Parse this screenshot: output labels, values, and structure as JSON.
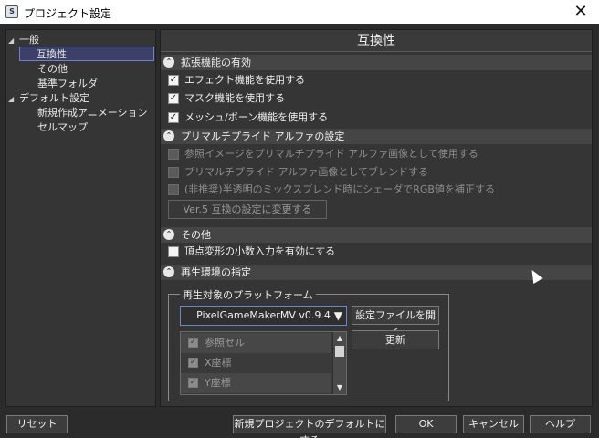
{
  "window": {
    "title": "プロジェクト設定",
    "close": "✕"
  },
  "tree": {
    "items": [
      {
        "label": "一般",
        "arrow": "◢"
      },
      {
        "label": "互換性"
      },
      {
        "label": "その他"
      },
      {
        "label": "基準フォルダ"
      },
      {
        "label": "デフォルト設定",
        "arrow": "◢"
      },
      {
        "label": "新規作成アニメーション"
      },
      {
        "label": "セルマップ"
      }
    ]
  },
  "panel": {
    "title": "互換性",
    "sections": {
      "ext": {
        "header": "拡張機能の有効",
        "items": [
          {
            "label": "エフェクト機能を使用する",
            "check": "✓"
          },
          {
            "label": "マスク機能を使用する",
            "check": "✓"
          },
          {
            "label": "メッシュ/ボーン機能を使用する",
            "check": "✓"
          }
        ]
      },
      "premul": {
        "header": "プリマルチプライド アルファの設定",
        "items": [
          {
            "label": "参照イメージをプリマルチプライド アルファ画像として使用する"
          },
          {
            "label": "プリマルチプライド アルファ画像としてブレンドする"
          },
          {
            "label": "(非推奨)半透明のミックスブレンド時にシェーダでRGB値を補正する"
          }
        ],
        "ver5_button": "Ver.5 互換の設定に変更する"
      },
      "other": {
        "header": "その他",
        "items": [
          {
            "label": "頂点変形の小数入力を有効にする"
          }
        ]
      },
      "playback": {
        "header": "再生環境の指定",
        "group_label": "再生対象のプラットフォーム",
        "platform": "PixelGameMakerMV v0.9.4",
        "open_settings": "設定ファイルを開く",
        "update": "更新",
        "list": [
          {
            "label": "参照セル",
            "check": "✓"
          },
          {
            "label": "X座標",
            "check": "✓"
          },
          {
            "label": "Y座標",
            "check": "✓"
          }
        ]
      }
    }
  },
  "footer": {
    "reset": "リセット",
    "default": "新規プロジェクトのデフォルトにする",
    "ok": "OK",
    "cancel": "キャンセル",
    "help": "ヘルプ"
  },
  "icons": {
    "collapse": "⌃",
    "caret": "▼",
    "scroll_up": "▲",
    "scroll_down": "▼"
  }
}
